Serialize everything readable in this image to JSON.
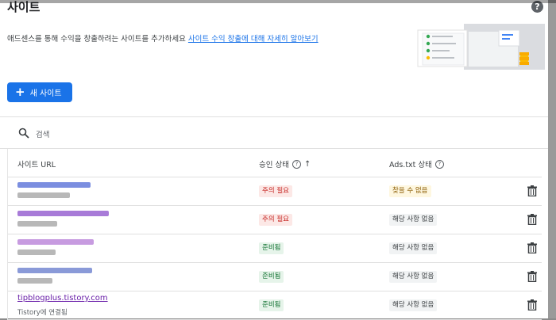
{
  "header": {
    "title": "사이트",
    "description": "애드센스를 통해 수익을 창출하려는 사이트를 추가하세요",
    "learn_more": "사이트 수익 창출에 대해 자세히 알아보기"
  },
  "toolbar": {
    "add_site_label": "새 사이트"
  },
  "search": {
    "placeholder": "검색"
  },
  "table": {
    "columns": [
      "사이트 URL",
      "승인 상태",
      "Ads.txt 상태"
    ],
    "rows": [
      {
        "url": "",
        "sub": "",
        "approval": "주의 필요",
        "approval_color": "#c5221f",
        "ads": "찾을 수 없음",
        "ads_color": "#8a5a00"
      },
      {
        "url": "",
        "sub": "",
        "approval": "주의 필요",
        "approval_color": "#c5221f",
        "ads": "해당 사항 없음",
        "ads_color": "#3c4043"
      },
      {
        "url": "",
        "sub": "",
        "approval": "준비됨",
        "approval_color": "#137333",
        "ads": "해당 사항 없음",
        "ads_color": "#3c4043"
      },
      {
        "url": "",
        "sub": "",
        "approval": "준비됨",
        "approval_color": "#137333",
        "ads": "해당 사항 없음",
        "ads_color": "#3c4043"
      },
      {
        "url": "tipblogplus.tistory.com",
        "sub": "Tistory에 연결됨",
        "approval": "준비됨",
        "approval_color": "#137333",
        "ads": "해당 사항 없음",
        "ads_color": "#3c4043"
      }
    ]
  },
  "icons": {
    "help": "help-icon",
    "add": "plus-icon",
    "search": "search-icon",
    "sort": "arrow-up-icon",
    "delete": "trash-icon"
  },
  "colors": {
    "primary": "#1a73e8",
    "link": "#1a73e8"
  }
}
